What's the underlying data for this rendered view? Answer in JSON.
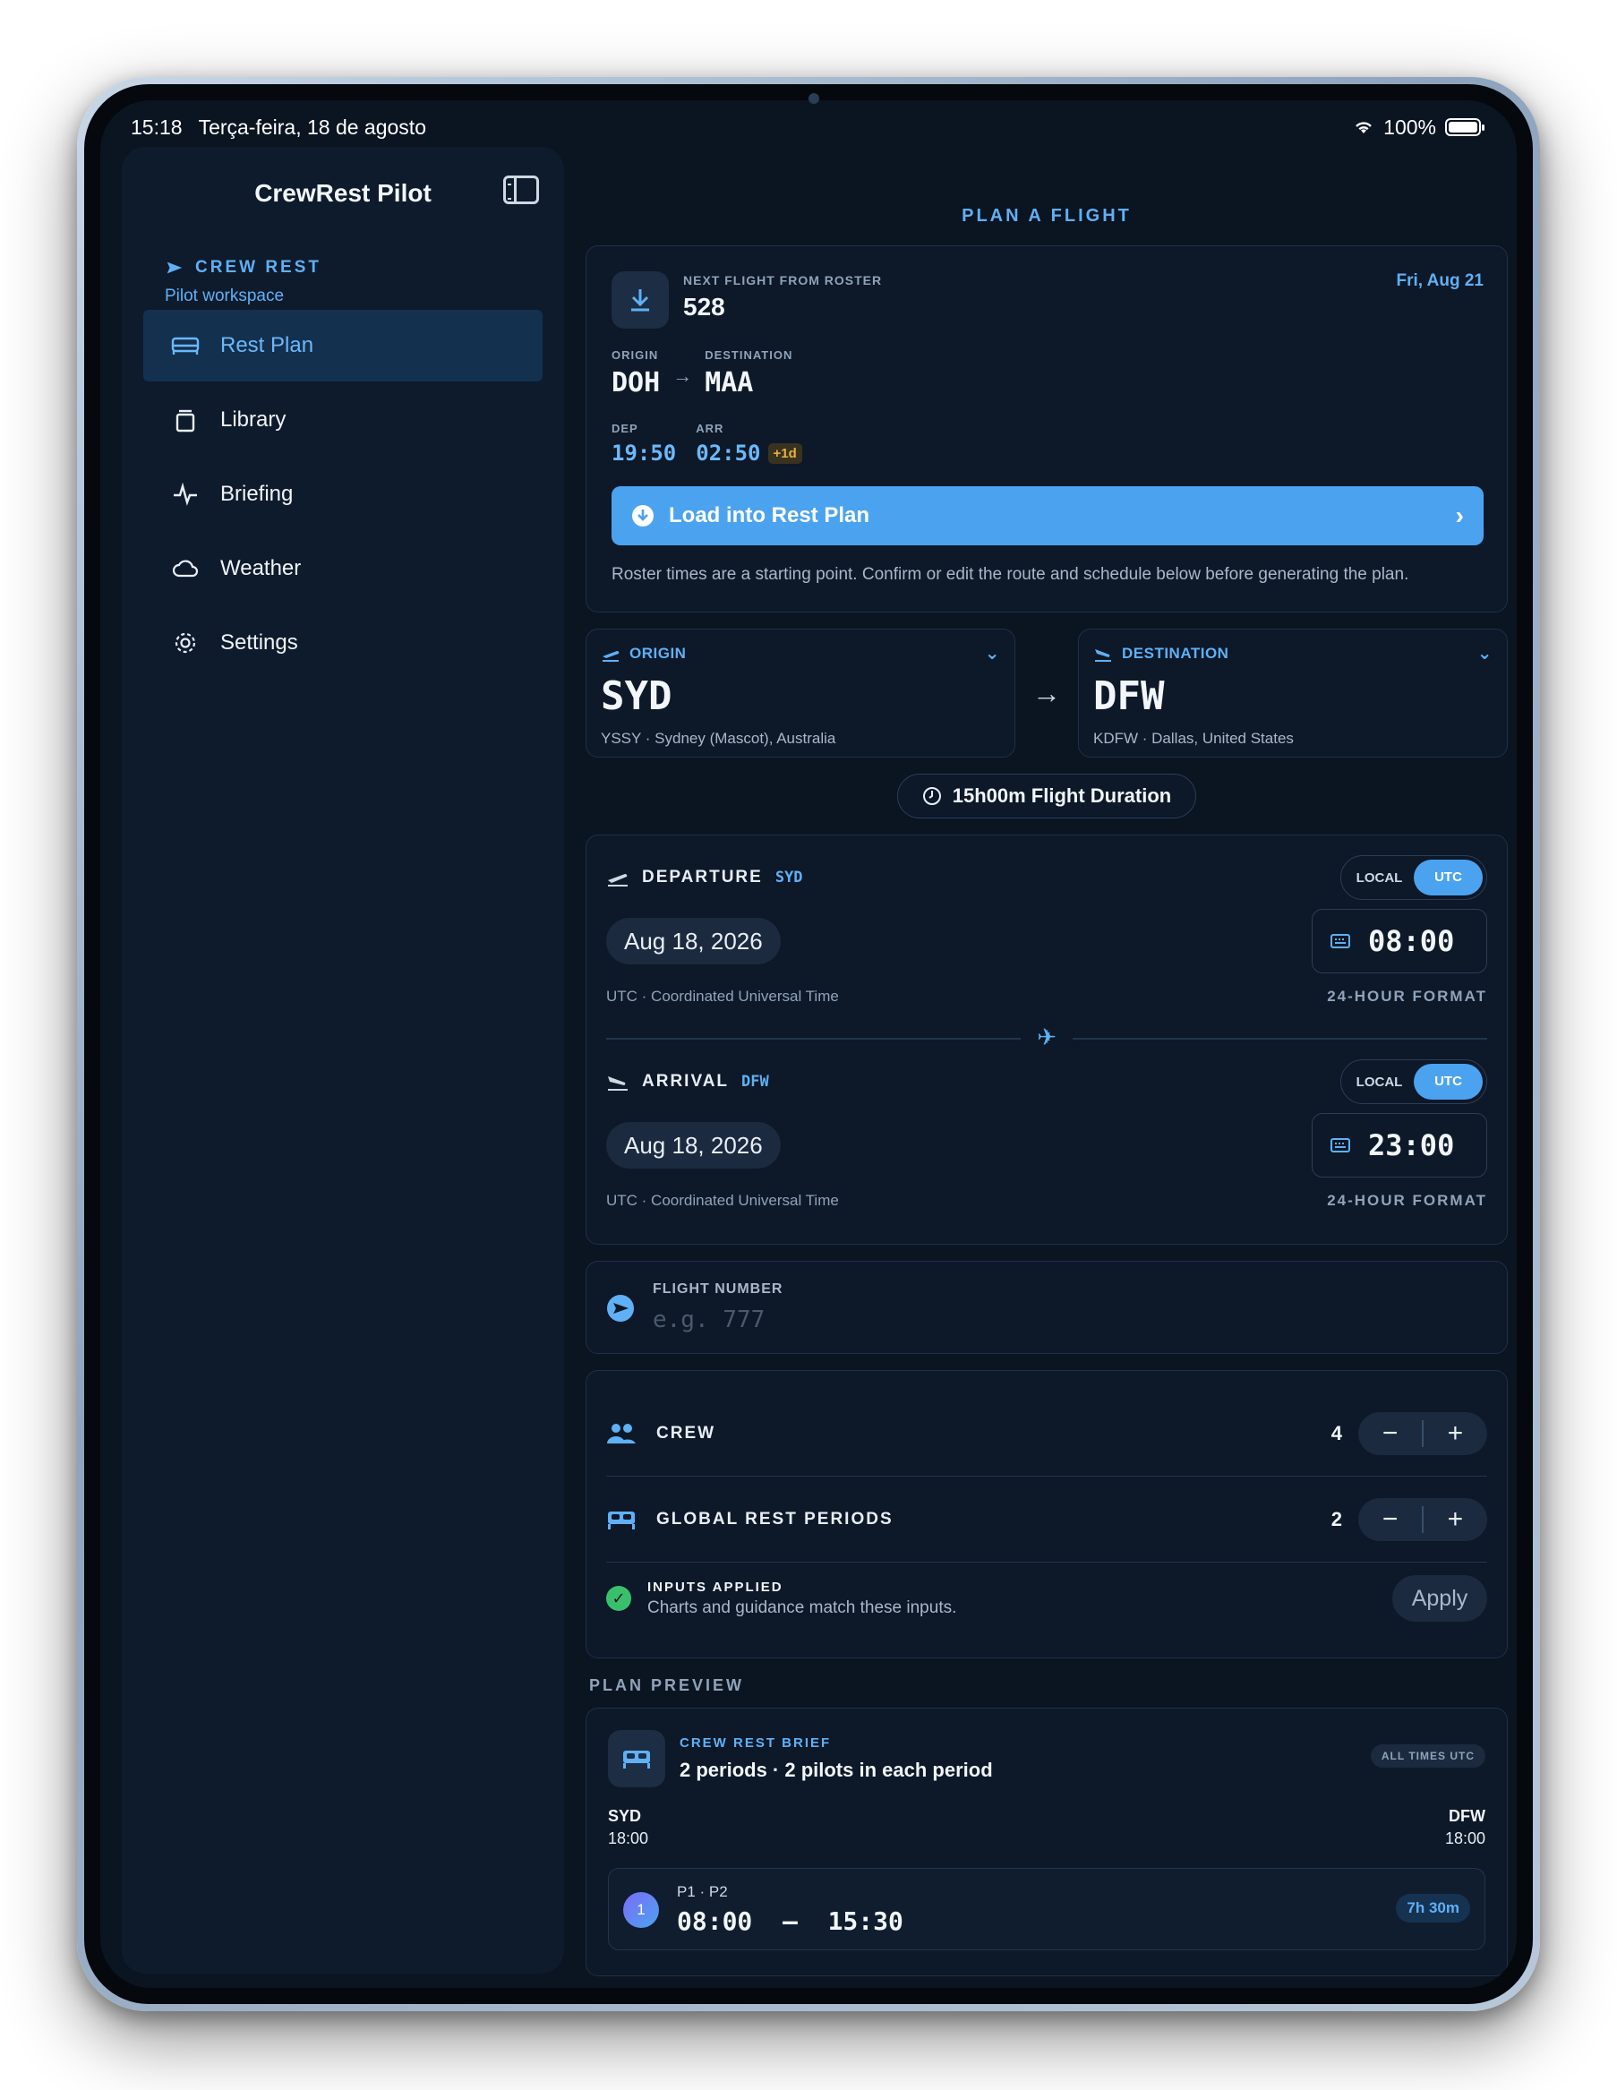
{
  "status": {
    "time": "15:18",
    "date": "Terça-feira, 18 de agosto",
    "battery": "100%"
  },
  "sidebar": {
    "title": "CrewRest Pilot",
    "brand_label": "CREW REST",
    "brand_sub": "Pilot workspace",
    "items": [
      {
        "label": "Rest Plan",
        "icon": "bed-icon",
        "active": true
      },
      {
        "label": "Library",
        "icon": "library-icon"
      },
      {
        "label": "Briefing",
        "icon": "pulse-icon"
      },
      {
        "label": "Weather",
        "icon": "cloud-icon"
      },
      {
        "label": "Settings",
        "icon": "gear-icon"
      }
    ]
  },
  "main": {
    "section_title": "PLAN A FLIGHT",
    "roster": {
      "caption": "NEXT FLIGHT FROM ROSTER",
      "flight": "528",
      "date": "Fri, Aug 21",
      "origin_cap": "ORIGIN",
      "origin": "DOH",
      "dest_cap": "DESTINATION",
      "dest": "MAA",
      "dep_cap": "DEP",
      "dep": "19:50",
      "arr_cap": "ARR",
      "arr": "02:50",
      "arr_offset": "+1d",
      "button": "Load into Rest Plan",
      "note": "Roster times are a starting point. Confirm or edit the route and schedule below before generating the plan."
    },
    "origin": {
      "cap": "ORIGIN",
      "code": "SYD",
      "sub": "YSSY · Sydney (Mascot), Australia"
    },
    "destination": {
      "cap": "DESTINATION",
      "code": "DFW",
      "sub": "KDFW · Dallas, United States"
    },
    "duration": "15h00m  Flight Duration",
    "departure": {
      "title": "DEPARTURE",
      "code": "SYD",
      "local": "LOCAL",
      "utc": "UTC",
      "date": "Aug 18, 2026",
      "time": "08:00",
      "tz": "UTC · Coordinated Universal Time",
      "format": "24-HOUR FORMAT"
    },
    "arrival": {
      "title": "ARRIVAL",
      "code": "DFW",
      "local": "LOCAL",
      "utc": "UTC",
      "date": "Aug 18, 2026",
      "time": "23:00",
      "tz": "UTC · Coordinated Universal Time",
      "format": "24-HOUR FORMAT"
    },
    "flight_number": {
      "label": "FLIGHT NUMBER",
      "placeholder": "e.g. 777"
    },
    "crew": {
      "label": "CREW",
      "value": "4"
    },
    "rest_periods": {
      "label": "GLOBAL REST PERIODS",
      "value": "2"
    },
    "stepper": {
      "minus": "−",
      "plus": "+"
    },
    "applied": {
      "title": "INPUTS APPLIED",
      "sub": "Charts and guidance match these inputs.",
      "button": "Apply"
    },
    "preview": {
      "title": "PLAN PREVIEW",
      "cap": "CREW REST BRIEF",
      "headline": "2 periods · 2 pilots in each period",
      "utc_badge": "ALL TIMES UTC",
      "from_code": "SYD",
      "from_time": "18:00",
      "to_code": "DFW",
      "to_time": "18:00",
      "period": {
        "num": "1",
        "pilots": "P1 · P2",
        "times": "08:00  –  15:30",
        "duration": "7h 30m"
      }
    }
  },
  "colors": {
    "accent": "#4ba3f0",
    "background": "#0b1421",
    "card": "#0d1828",
    "success": "#39c06d"
  }
}
